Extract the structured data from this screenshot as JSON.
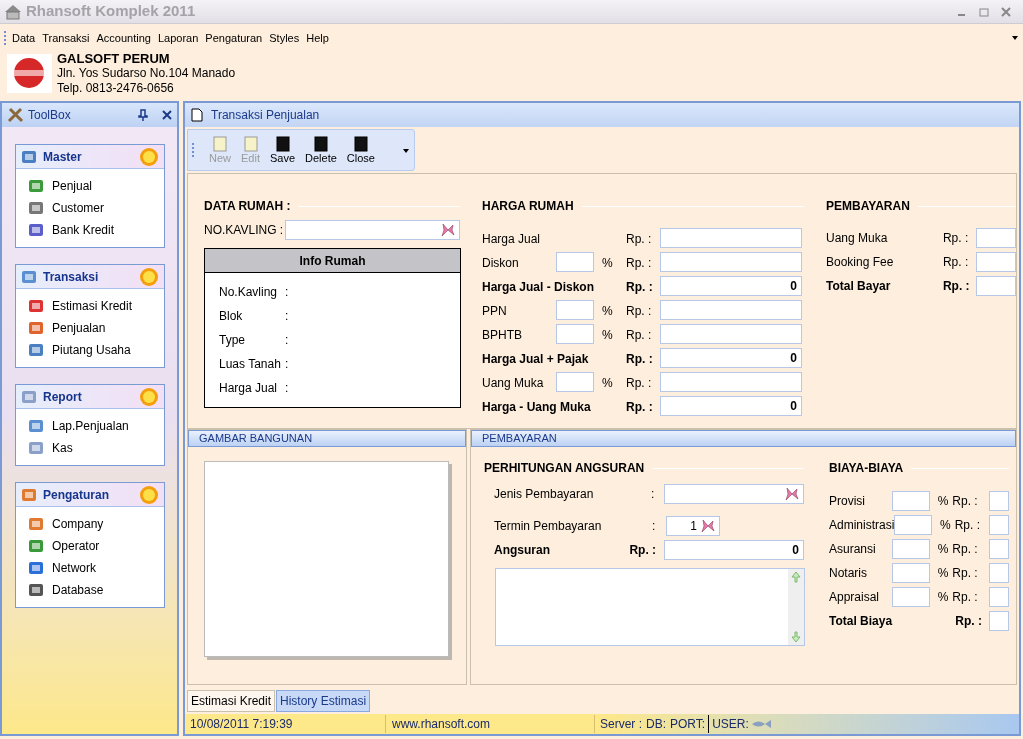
{
  "window": {
    "title": "Rhansoft Komplek 2011"
  },
  "menu": [
    {
      "label": "Data"
    },
    {
      "label": "Transaksi"
    },
    {
      "label": "Accounting"
    },
    {
      "label": "Laporan"
    },
    {
      "label": "Pengaturan"
    },
    {
      "label": "Styles"
    },
    {
      "label": "Help"
    }
  ],
  "company": {
    "name": "GALSOFT PERUM",
    "address": "Jln. Yos Sudarso No.104 Manado",
    "phone": "Telp. 0813-2476-0656"
  },
  "toolbox": {
    "title": "ToolBox",
    "groups": [
      {
        "title": "Master",
        "items": [
          {
            "label": "Penjual"
          },
          {
            "label": "Customer"
          },
          {
            "label": "Bank Kredit"
          }
        ]
      },
      {
        "title": "Transaksi",
        "items": [
          {
            "label": "Estimasi Kredit"
          },
          {
            "label": "Penjualan"
          },
          {
            "label": "Piutang Usaha"
          }
        ]
      },
      {
        "title": "Report",
        "items": [
          {
            "label": "Lap.Penjualan"
          },
          {
            "label": "Kas"
          }
        ]
      },
      {
        "title": "Pengaturan",
        "items": [
          {
            "label": "Company"
          },
          {
            "label": "Operator"
          },
          {
            "label": "Network"
          },
          {
            "label": "Database"
          }
        ]
      }
    ]
  },
  "document": {
    "title": "Transaksi Penjualan",
    "toolbar": [
      {
        "label": "New",
        "disabled": true
      },
      {
        "label": "Edit",
        "disabled": true
      },
      {
        "label": "Save",
        "disabled": false
      },
      {
        "label": "Delete",
        "disabled": false
      },
      {
        "label": "Close",
        "disabled": false
      }
    ],
    "data_rumah": {
      "heading": "DATA RUMAH :",
      "kavling_label": "NO.KAVLING  :",
      "info_title": "Info Rumah",
      "info_rows": [
        {
          "label": "No.Kavling",
          "sep": ":"
        },
        {
          "label": "Blok",
          "sep": ":"
        },
        {
          "label": "Type",
          "sep": ":"
        },
        {
          "label": "Luas Tanah",
          "sep": ":"
        },
        {
          "label": "Harga Jual",
          "sep": ":"
        }
      ]
    },
    "harga_rumah": {
      "heading": "HARGA RUMAH",
      "rows": [
        {
          "kind": "amount",
          "label": "Harga Jual",
          "rp": "Rp. :",
          "bold": false
        },
        {
          "kind": "percent",
          "label": "Diskon",
          "pct": "%",
          "rp": "Rp. :",
          "bold": false
        },
        {
          "kind": "amount",
          "label": "Harga Jual - Diskon",
          "rp": "Rp. :",
          "bold": true,
          "value": "0"
        },
        {
          "kind": "percent",
          "label": "PPN",
          "pct": "%",
          "rp": "Rp. :",
          "bold": false
        },
        {
          "kind": "percent",
          "label": "BPHTB",
          "pct": "%",
          "rp": "Rp. :",
          "bold": false
        },
        {
          "kind": "amount",
          "label": "Harga Jual + Pajak",
          "rp": "Rp. :",
          "bold": true,
          "value": "0"
        },
        {
          "kind": "percent",
          "label": "Uang Muka",
          "pct": "%",
          "rp": "Rp. :",
          "bold": false
        },
        {
          "kind": "amount",
          "label": "Harga - Uang Muka",
          "rp": "Rp. :",
          "bold": true,
          "value": "0"
        }
      ]
    },
    "pembayaran": {
      "heading": "PEMBAYARAN",
      "rows": [
        {
          "label": "Uang Muka",
          "rp": "Rp. :",
          "bold": false
        },
        {
          "label": "Booking Fee",
          "rp": "Rp. :",
          "bold": false
        },
        {
          "label": "Total Bayar",
          "rp": "Rp. :",
          "bold": true
        }
      ]
    },
    "gambar": {
      "title": "GAMBAR BANGUNAN"
    },
    "pembayaran_panel": {
      "title": "PEMBAYARAN",
      "angsuran": {
        "heading": "PERHITUNGAN ANGSURAN",
        "jenis_label": "Jenis Pembayaran",
        "jenis_sep": ":",
        "termin_label": "Termin Pembayaran",
        "termin_sep": ":",
        "termin_value": "1",
        "angsuran_label": "Angsuran",
        "angsuran_rp": "Rp. :",
        "angsuran_value": "0"
      },
      "biaya": {
        "heading": "BIAYA-BIAYA",
        "rows": [
          {
            "label": "Provisi",
            "pct": "%",
            "rp": "Rp. :"
          },
          {
            "label": "Administrasi",
            "pct": "%",
            "rp": "Rp. :"
          },
          {
            "label": "Asuransi",
            "pct": "%",
            "rp": "Rp. :"
          },
          {
            "label": "Notaris",
            "pct": "%",
            "rp": "Rp. :"
          },
          {
            "label": "Appraisal",
            "pct": "%",
            "rp": "Rp. :"
          }
        ],
        "total_label": "Total Biaya",
        "total_rp": "Rp. :"
      }
    }
  },
  "tabs": [
    {
      "label": "Estimasi Kredit",
      "selected": true
    },
    {
      "label": "History Estimasi",
      "selected": false
    }
  ],
  "status_bar": {
    "datetime": "10/08/2011 7:19:39",
    "website": "www.rhansoft.com",
    "server": "Server :",
    "db": "DB:",
    "port": "PORT:",
    "user": "USER:"
  }
}
